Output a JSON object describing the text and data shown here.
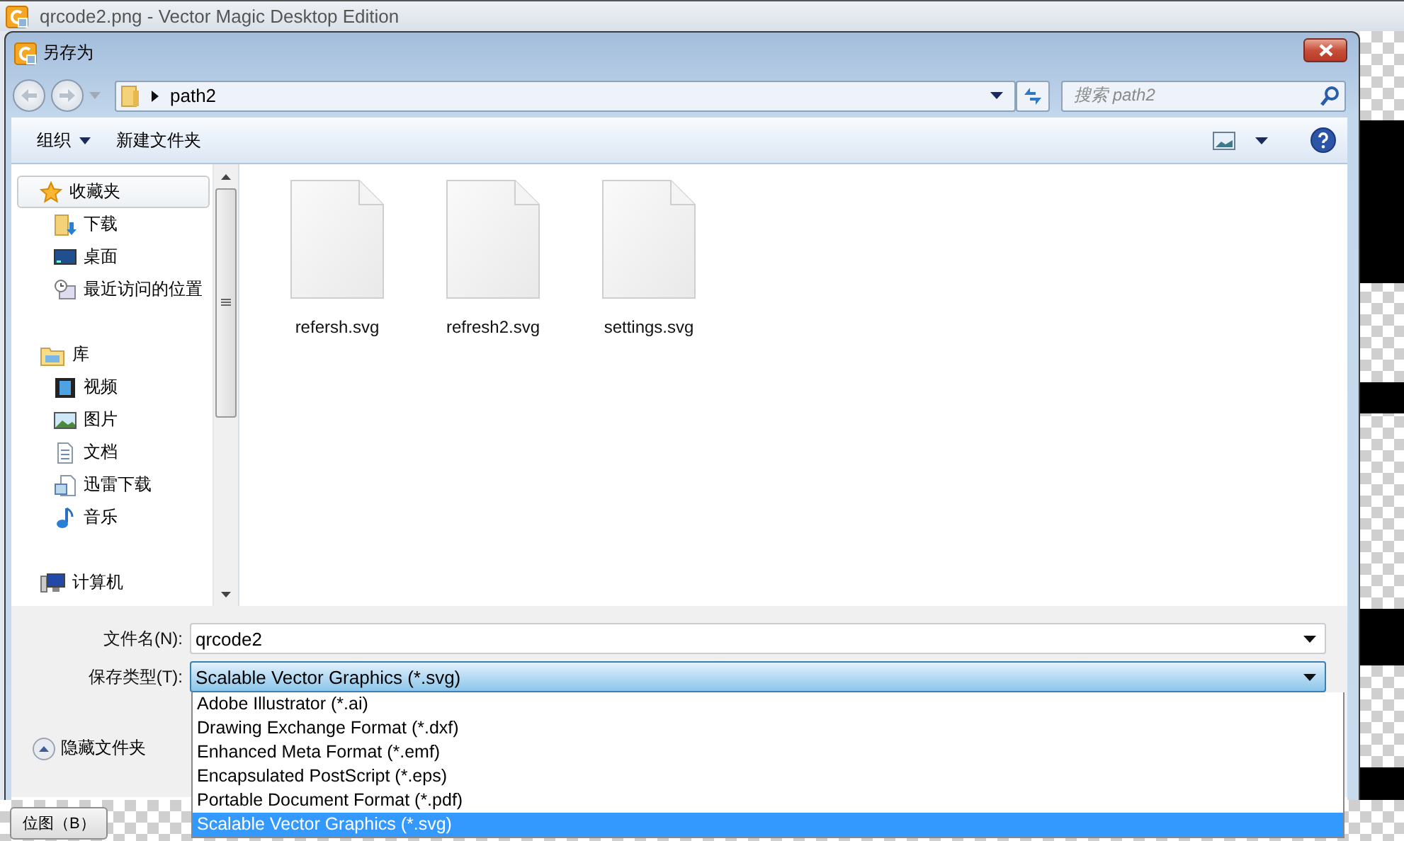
{
  "app": {
    "title": "qrcode2.png - Vector Magic Desktop Edition",
    "bottom_button": "位图（B）"
  },
  "dialog": {
    "title": "另存为",
    "address": {
      "path": "path2"
    },
    "search": {
      "placeholder": "搜索 path2"
    },
    "toolbar": {
      "organize": "组织",
      "new_folder": "新建文件夹"
    },
    "nav": [
      {
        "label": "收藏夹",
        "kind": "star",
        "selected": true,
        "children": [
          {
            "label": "下载",
            "kind": "downloads",
            "selected": false
          },
          {
            "label": "桌面",
            "kind": "desktop",
            "selected": false
          },
          {
            "label": "最近访问的位置",
            "kind": "recent",
            "selected": false
          }
        ]
      },
      {
        "label": "库",
        "kind": "library",
        "selected": false,
        "children": [
          {
            "label": "视频",
            "kind": "video",
            "selected": false
          },
          {
            "label": "图片",
            "kind": "pictures",
            "selected": false
          },
          {
            "label": "文档",
            "kind": "documents",
            "selected": false
          },
          {
            "label": "迅雷下载",
            "kind": "thunder",
            "selected": false
          },
          {
            "label": "音乐",
            "kind": "music",
            "selected": false
          }
        ]
      },
      {
        "label": "计算机",
        "kind": "computer",
        "selected": false
      }
    ],
    "files": [
      {
        "name": "refersh.svg"
      },
      {
        "name": "refresh2.svg"
      },
      {
        "name": "settings.svg"
      }
    ],
    "filename": {
      "label": "文件名(N):",
      "value": "qrcode2"
    },
    "save_type": {
      "label": "保存类型(T):",
      "value": "Scalable Vector Graphics (*.svg)",
      "expanded": true,
      "options": [
        {
          "label": "Adobe Illustrator (*.ai)",
          "selected": false
        },
        {
          "label": "Drawing Exchange Format (*.dxf)",
          "selected": false
        },
        {
          "label": "Enhanced Meta Format (*.emf)",
          "selected": false
        },
        {
          "label": "Encapsulated PostScript (*.eps)",
          "selected": false
        },
        {
          "label": "Portable Document Format (*.pdf)",
          "selected": false
        },
        {
          "label": "Scalable Vector Graphics (*.svg)",
          "selected": true
        }
      ]
    },
    "hide_folders": "隐藏文件夹"
  }
}
